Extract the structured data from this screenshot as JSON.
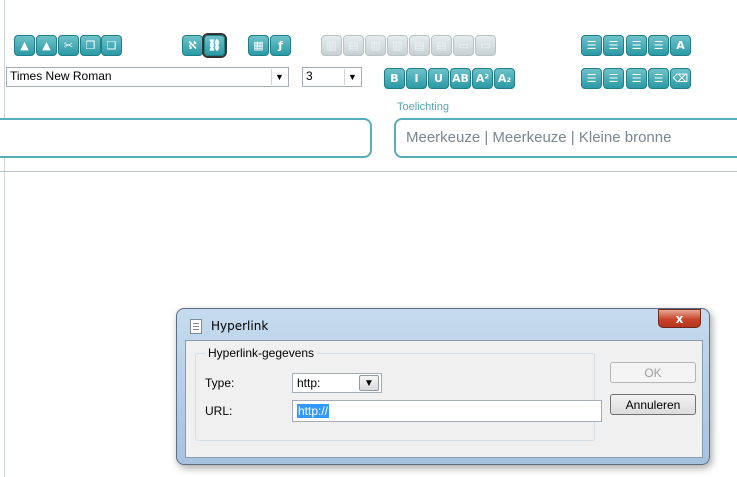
{
  "toolbar": {
    "font_name": "Times New Roman",
    "font_size": "3",
    "row1_buttons": [
      {
        "name": "image-icon",
        "glyph": "▲",
        "dim": false
      },
      {
        "name": "image-dim-icon",
        "glyph": "▲",
        "dim": false
      },
      {
        "name": "cut-icon",
        "glyph": "✂",
        "dim": false
      },
      {
        "name": "copy-icon",
        "glyph": "❐",
        "dim": false
      },
      {
        "name": "paste-icon",
        "glyph": "❑",
        "dim": false
      },
      {
        "name": "special-char-icon",
        "glyph": "ℵ",
        "dim": false
      },
      {
        "name": "hyperlink-icon",
        "glyph": "⛓",
        "dim": false,
        "selected": true
      },
      {
        "name": "table-icon",
        "glyph": "▦",
        "dim": false
      },
      {
        "name": "formula-icon",
        "glyph": "ƒ",
        "dim": false
      },
      {
        "name": "table-insert-col-icon",
        "glyph": "▥",
        "dim": true
      },
      {
        "name": "table-insert-row-icon",
        "glyph": "▤",
        "dim": true
      },
      {
        "name": "table-col-right-icon",
        "glyph": "▥",
        "dim": true
      },
      {
        "name": "table-col-left-icon",
        "glyph": "▥",
        "dim": true
      },
      {
        "name": "table-row-below-icon",
        "glyph": "▤",
        "dim": true
      },
      {
        "name": "table-row-above-icon",
        "glyph": "▤",
        "dim": true
      },
      {
        "name": "table-merge-icon",
        "glyph": "▭",
        "dim": true
      },
      {
        "name": "table-split-icon",
        "glyph": "▭",
        "dim": true
      },
      {
        "name": "numbered-list-icon",
        "glyph": "☰",
        "dim": false
      },
      {
        "name": "bullet-list-icon",
        "glyph": "☰",
        "dim": false
      },
      {
        "name": "outdent-icon",
        "glyph": "☰",
        "dim": false
      },
      {
        "name": "indent-icon",
        "glyph": "☰",
        "dim": false
      },
      {
        "name": "color-icon",
        "glyph": "A",
        "dim": false
      }
    ],
    "row2_buttons": [
      {
        "name": "bold-icon",
        "glyph": "B"
      },
      {
        "name": "italic-icon",
        "glyph": "I"
      },
      {
        "name": "underline-icon",
        "glyph": "U"
      },
      {
        "name": "strikethrough-icon",
        "glyph": "AB"
      },
      {
        "name": "superscript-icon",
        "glyph": "A²"
      },
      {
        "name": "subscript-icon",
        "glyph": "A₂"
      },
      {
        "name": "align-left-icon",
        "glyph": "☰"
      },
      {
        "name": "align-center-icon",
        "glyph": "☰"
      },
      {
        "name": "align-right-icon",
        "glyph": "☰"
      },
      {
        "name": "align-justify-icon",
        "glyph": "☰"
      },
      {
        "name": "eraser-icon",
        "glyph": "⌫"
      }
    ]
  },
  "form": {
    "toelichting_label": "Toelichting",
    "toelichting_value": "Meerkeuze | Meerkeuze | Kleine bronne"
  },
  "dialog": {
    "title": "Hyperlink",
    "close_glyph": "x",
    "group_label": "Hyperlink-gegevens",
    "type_label": "Type:",
    "type_value": "http:",
    "url_label": "URL:",
    "url_value": "http://",
    "ok_label": "OK",
    "cancel_label": "Annuleren"
  },
  "colors": {
    "accent": "#2a9aa6",
    "accent_border": "#58aeb6",
    "dialog_frame": "#a6c2de",
    "close_red": "#c7442a",
    "selection": "#3399ff"
  }
}
